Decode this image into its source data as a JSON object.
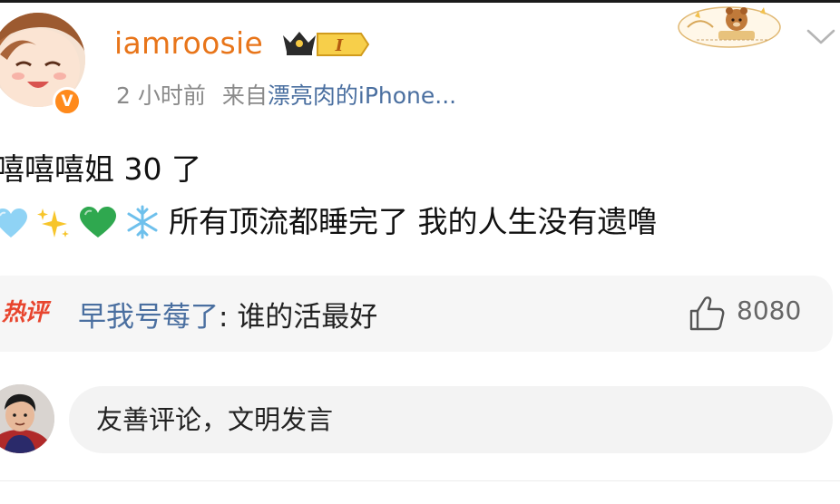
{
  "post": {
    "username": "iamroosie",
    "level_badge": "I",
    "time": "2 小时前",
    "source_prefix": "来自",
    "source_device": "漂亮肉的iPhone...",
    "verified_mark": "V",
    "line1": "嘻嘻嘻姐 30 了",
    "line2_text": "所有顶流都睡完了 我的人生没有遗噜",
    "line2_emojis": [
      "light-blue-heart-icon",
      "sparkles-icon",
      "green-heart-icon",
      "snowflake-icon"
    ]
  },
  "hot_comment": {
    "label": "热评",
    "commenter": "早我号莓了",
    "separator": ": ",
    "text": "谁的活最好",
    "likes": "8080"
  },
  "composer": {
    "placeholder": "友善评论，文明发言"
  },
  "colors": {
    "username": "#e8751a",
    "link_blue": "#4a6fa0",
    "hot_label_red": "#e8452e",
    "verified_orange": "#ff8a1c",
    "meta_gray": "#8a8a8a",
    "card_bg": "#f6f6f6"
  }
}
